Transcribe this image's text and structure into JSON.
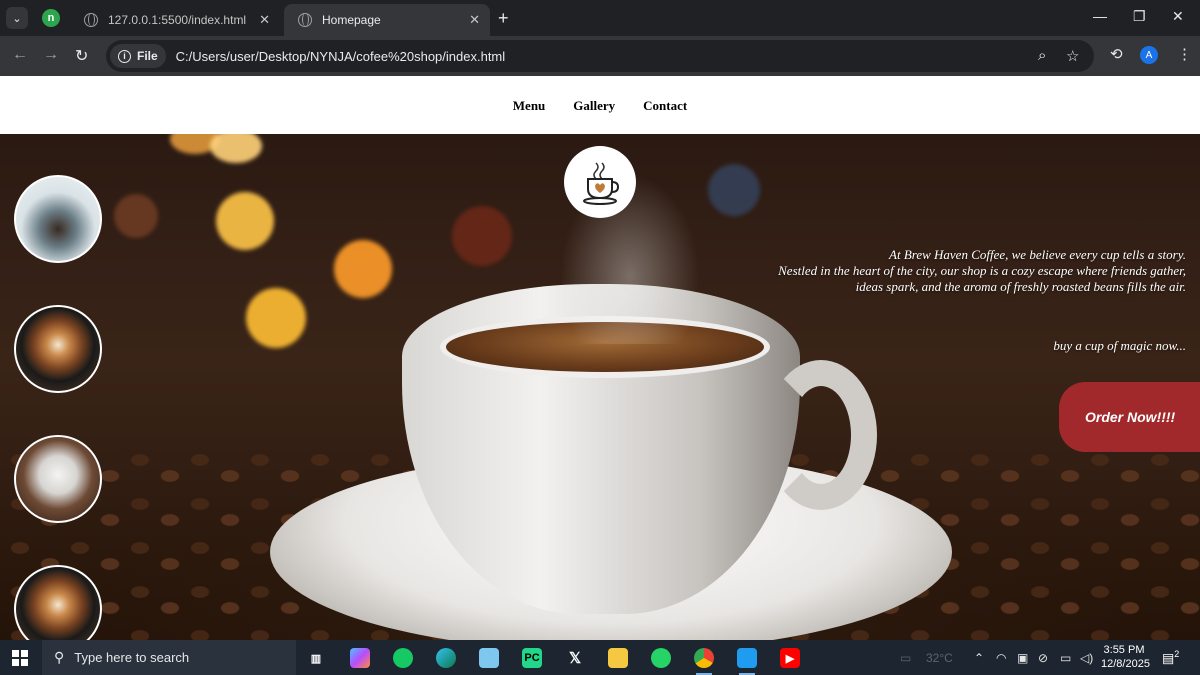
{
  "browser": {
    "tabs": [
      {
        "title": "127.0.0.1:5500/index.html",
        "active": false
      },
      {
        "title": "Homepage",
        "active": true
      }
    ],
    "address": {
      "chip_label": "File",
      "url": "C:/Users/user/Desktop/NYNJA/cofee%20shop/index.html"
    },
    "profile_initial": "A"
  },
  "site": {
    "nav": [
      "Menu",
      "Gallery",
      "Contact"
    ],
    "story": [
      "At Brew Haven Coffee, we believe every cup tells a story.",
      "Nestled in the heart of the city, our shop is a cozy escape where friends gather,",
      "ideas spark, and the aroma of freshly roasted beans fills the air."
    ],
    "tagline": "buy a cup of magic now...",
    "order_button": "Order Now!!!!",
    "colors": {
      "order_button": "#a1282b",
      "nav_bg": "#ffffff"
    }
  },
  "taskbar": {
    "search_placeholder": "Type here to search",
    "weather": "32°C",
    "time": "3:55 PM",
    "date": "12/8/2025",
    "notification_count": "2"
  }
}
